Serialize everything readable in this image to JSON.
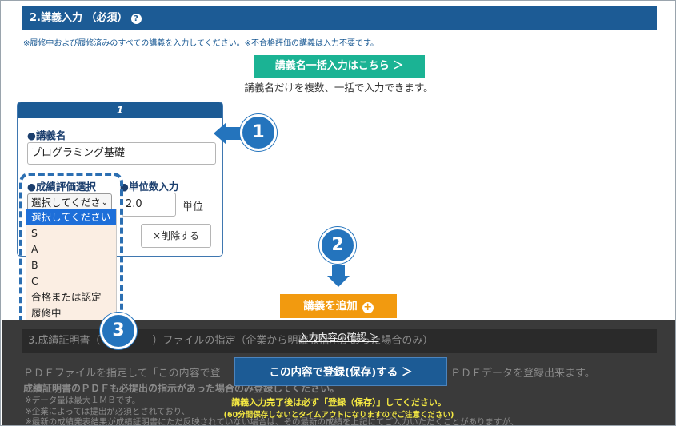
{
  "section2": {
    "title": "2.講義入力 （必須）",
    "help_icon": "?",
    "note": "※履修中および履修済みのすべての講義を入力してください。※不合格評価の講義は入力不要です。"
  },
  "bulk_input": {
    "button_label": "講義名一括入力はこちら ＞",
    "subtext": "講義名だけを複数、一括で入力できます。"
  },
  "lecture_card": {
    "number": "1",
    "name_label": "●講義名",
    "name_value": "プログラミング基礎",
    "grade_label": "●成績評価選択",
    "grade_selected": "選択してくださ",
    "grade_caret": "⌄",
    "units_label": "●単位数入力",
    "units_value": "2.0",
    "units_suffix": "単位",
    "delete_label": "×削除する"
  },
  "grade_options": [
    "選択してください",
    "S",
    "A",
    "B",
    "C",
    "合格または認定",
    "履修中"
  ],
  "markers": [
    "1",
    "2",
    "3"
  ],
  "add_button": {
    "label": "講義を追加",
    "icon": "+"
  },
  "confirm_link": "入力内容の確認 ＞",
  "section3": {
    "title": "3.成績証明書（　　　　　）ファイルの指定（企業から明確な指示があった場合のみ）",
    "line1_left": "ＰＤＦファイルを指定して「この内容で登",
    "line1_right": "ＰＤＦデータを登録出来ます。",
    "line2": "成績証明書のＰＤＦも必提出の指示があった場合のみ登録してください。",
    "line3": "※データ量は最大１ＭＢです。",
    "line4": "※企業によっては提出が必須とされており、",
    "line5": "※最新の成績発表結果が成績証明書にただ反映されていない場合は、その最新の成績を上記にてご入力いただくことがありますが、"
  },
  "save_button": "この内容で登録(保存)する ＞",
  "warnings": {
    "line1": "講義入力完了後は必ず「登録（保存）」してください。",
    "line2": "(60分間保存しないとタイムアウトになりますのでご注意ください)"
  },
  "colors": {
    "section_header": "#1c5b95",
    "bulk_button": "#1bb394",
    "add_button": "#f29a0f",
    "marker": "#2474bd",
    "warning_text": "#f4e842"
  }
}
